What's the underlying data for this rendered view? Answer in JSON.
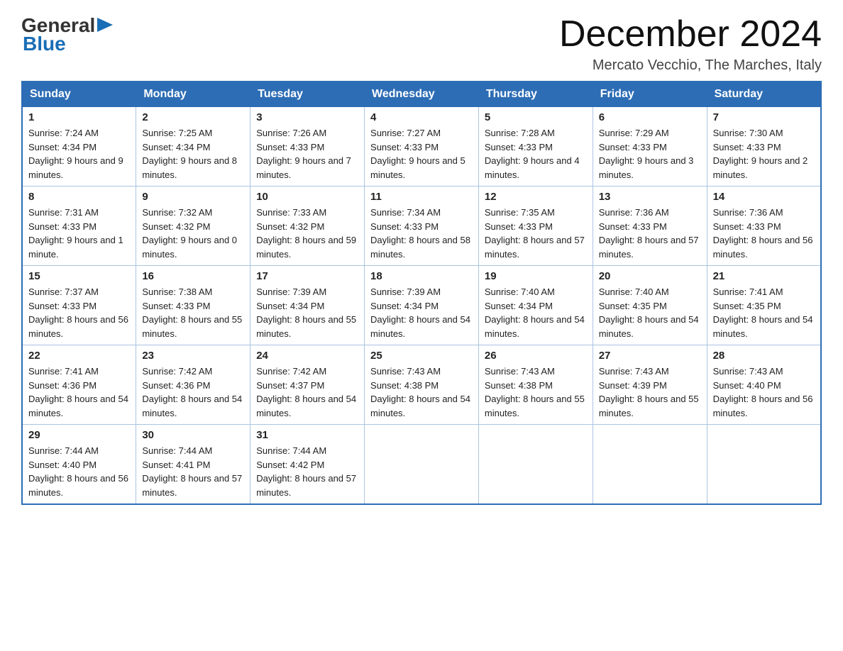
{
  "header": {
    "month_title": "December 2024",
    "location": "Mercato Vecchio, The Marches, Italy"
  },
  "logo": {
    "general": "General",
    "blue": "Blue"
  },
  "days_of_week": [
    "Sunday",
    "Monday",
    "Tuesday",
    "Wednesday",
    "Thursday",
    "Friday",
    "Saturday"
  ],
  "weeks": [
    [
      {
        "day": "1",
        "sunrise": "7:24 AM",
        "sunset": "4:34 PM",
        "daylight": "9 hours and 9 minutes."
      },
      {
        "day": "2",
        "sunrise": "7:25 AM",
        "sunset": "4:34 PM",
        "daylight": "9 hours and 8 minutes."
      },
      {
        "day": "3",
        "sunrise": "7:26 AM",
        "sunset": "4:33 PM",
        "daylight": "9 hours and 7 minutes."
      },
      {
        "day": "4",
        "sunrise": "7:27 AM",
        "sunset": "4:33 PM",
        "daylight": "9 hours and 5 minutes."
      },
      {
        "day": "5",
        "sunrise": "7:28 AM",
        "sunset": "4:33 PM",
        "daylight": "9 hours and 4 minutes."
      },
      {
        "day": "6",
        "sunrise": "7:29 AM",
        "sunset": "4:33 PM",
        "daylight": "9 hours and 3 minutes."
      },
      {
        "day": "7",
        "sunrise": "7:30 AM",
        "sunset": "4:33 PM",
        "daylight": "9 hours and 2 minutes."
      }
    ],
    [
      {
        "day": "8",
        "sunrise": "7:31 AM",
        "sunset": "4:33 PM",
        "daylight": "9 hours and 1 minute."
      },
      {
        "day": "9",
        "sunrise": "7:32 AM",
        "sunset": "4:32 PM",
        "daylight": "9 hours and 0 minutes."
      },
      {
        "day": "10",
        "sunrise": "7:33 AM",
        "sunset": "4:32 PM",
        "daylight": "8 hours and 59 minutes."
      },
      {
        "day": "11",
        "sunrise": "7:34 AM",
        "sunset": "4:33 PM",
        "daylight": "8 hours and 58 minutes."
      },
      {
        "day": "12",
        "sunrise": "7:35 AM",
        "sunset": "4:33 PM",
        "daylight": "8 hours and 57 minutes."
      },
      {
        "day": "13",
        "sunrise": "7:36 AM",
        "sunset": "4:33 PM",
        "daylight": "8 hours and 57 minutes."
      },
      {
        "day": "14",
        "sunrise": "7:36 AM",
        "sunset": "4:33 PM",
        "daylight": "8 hours and 56 minutes."
      }
    ],
    [
      {
        "day": "15",
        "sunrise": "7:37 AM",
        "sunset": "4:33 PM",
        "daylight": "8 hours and 56 minutes."
      },
      {
        "day": "16",
        "sunrise": "7:38 AM",
        "sunset": "4:33 PM",
        "daylight": "8 hours and 55 minutes."
      },
      {
        "day": "17",
        "sunrise": "7:39 AM",
        "sunset": "4:34 PM",
        "daylight": "8 hours and 55 minutes."
      },
      {
        "day": "18",
        "sunrise": "7:39 AM",
        "sunset": "4:34 PM",
        "daylight": "8 hours and 54 minutes."
      },
      {
        "day": "19",
        "sunrise": "7:40 AM",
        "sunset": "4:34 PM",
        "daylight": "8 hours and 54 minutes."
      },
      {
        "day": "20",
        "sunrise": "7:40 AM",
        "sunset": "4:35 PM",
        "daylight": "8 hours and 54 minutes."
      },
      {
        "day": "21",
        "sunrise": "7:41 AM",
        "sunset": "4:35 PM",
        "daylight": "8 hours and 54 minutes."
      }
    ],
    [
      {
        "day": "22",
        "sunrise": "7:41 AM",
        "sunset": "4:36 PM",
        "daylight": "8 hours and 54 minutes."
      },
      {
        "day": "23",
        "sunrise": "7:42 AM",
        "sunset": "4:36 PM",
        "daylight": "8 hours and 54 minutes."
      },
      {
        "day": "24",
        "sunrise": "7:42 AM",
        "sunset": "4:37 PM",
        "daylight": "8 hours and 54 minutes."
      },
      {
        "day": "25",
        "sunrise": "7:43 AM",
        "sunset": "4:38 PM",
        "daylight": "8 hours and 54 minutes."
      },
      {
        "day": "26",
        "sunrise": "7:43 AM",
        "sunset": "4:38 PM",
        "daylight": "8 hours and 55 minutes."
      },
      {
        "day": "27",
        "sunrise": "7:43 AM",
        "sunset": "4:39 PM",
        "daylight": "8 hours and 55 minutes."
      },
      {
        "day": "28",
        "sunrise": "7:43 AM",
        "sunset": "4:40 PM",
        "daylight": "8 hours and 56 minutes."
      }
    ],
    [
      {
        "day": "29",
        "sunrise": "7:44 AM",
        "sunset": "4:40 PM",
        "daylight": "8 hours and 56 minutes."
      },
      {
        "day": "30",
        "sunrise": "7:44 AM",
        "sunset": "4:41 PM",
        "daylight": "8 hours and 57 minutes."
      },
      {
        "day": "31",
        "sunrise": "7:44 AM",
        "sunset": "4:42 PM",
        "daylight": "8 hours and 57 minutes."
      },
      null,
      null,
      null,
      null
    ]
  ],
  "labels": {
    "sunrise": "Sunrise:",
    "sunset": "Sunset:",
    "daylight": "Daylight:"
  }
}
